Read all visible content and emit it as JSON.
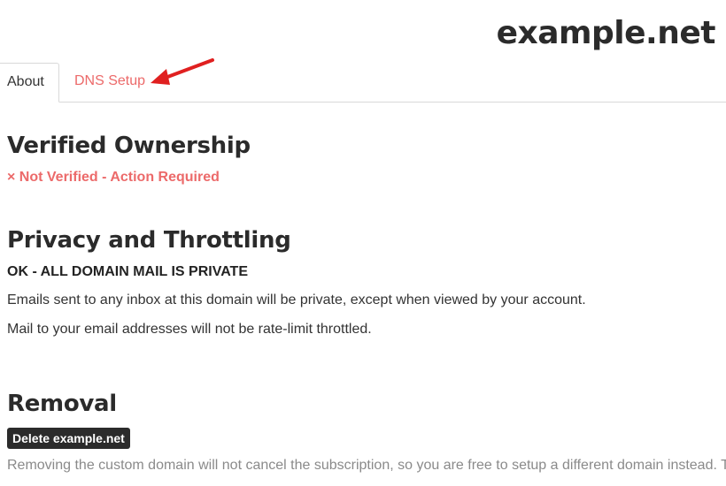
{
  "header": {
    "domain": "example.net"
  },
  "tabs": [
    {
      "label": "About"
    },
    {
      "label": "DNS Setup"
    }
  ],
  "ownership": {
    "title": "Verified Ownership",
    "status": "× Not Verified - Action Required"
  },
  "privacy": {
    "title": "Privacy and Throttling",
    "status": "OK - ALL DOMAIN MAIL IS PRIVATE",
    "line1": "Emails sent to any inbox at this domain will be private, except when viewed by your account.",
    "line2": "Mail to your email addresses will not be rate-limit throttled."
  },
  "removal": {
    "title": "Removal",
    "button_label": "Delete example.net",
    "note": "Removing the custom domain will not cancel the subscription, so you are free to setup a different domain instead. T"
  },
  "colors": {
    "accent": "#ec6a6a",
    "arrow": "#e02020",
    "button_bg": "#2b2b2b"
  }
}
